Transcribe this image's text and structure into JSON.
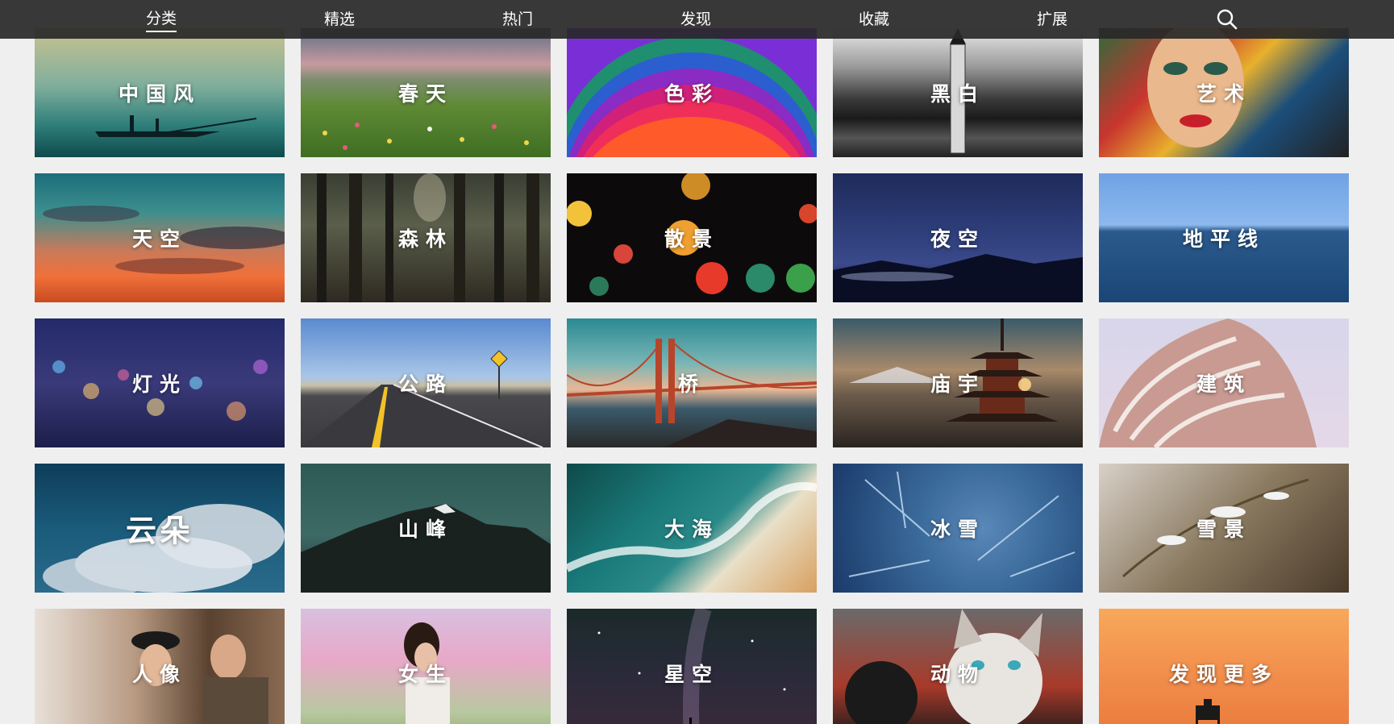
{
  "nav": {
    "items": [
      {
        "label": "分类",
        "active": true
      },
      {
        "label": "精选",
        "active": false
      },
      {
        "label": "热门",
        "active": false
      },
      {
        "label": "发现",
        "active": false
      },
      {
        "label": "收藏",
        "active": false
      },
      {
        "label": "扩展",
        "active": false
      }
    ],
    "search_icon": "search-icon"
  },
  "tiles": [
    {
      "label": "中国风"
    },
    {
      "label": "春天"
    },
    {
      "label": "色彩"
    },
    {
      "label": "黑白"
    },
    {
      "label": "艺术"
    },
    {
      "label": "天空"
    },
    {
      "label": "森林"
    },
    {
      "label": "散景"
    },
    {
      "label": "夜空"
    },
    {
      "label": "地平线"
    },
    {
      "label": "灯光"
    },
    {
      "label": "公路"
    },
    {
      "label": "桥"
    },
    {
      "label": "庙宇"
    },
    {
      "label": "建筑"
    },
    {
      "label": "云朵"
    },
    {
      "label": "山峰"
    },
    {
      "label": "大海"
    },
    {
      "label": "冰雪"
    },
    {
      "label": "雪景"
    },
    {
      "label": "人像"
    },
    {
      "label": "女生"
    },
    {
      "label": "星空"
    },
    {
      "label": "动物"
    },
    {
      "label": "发现更多"
    }
  ]
}
